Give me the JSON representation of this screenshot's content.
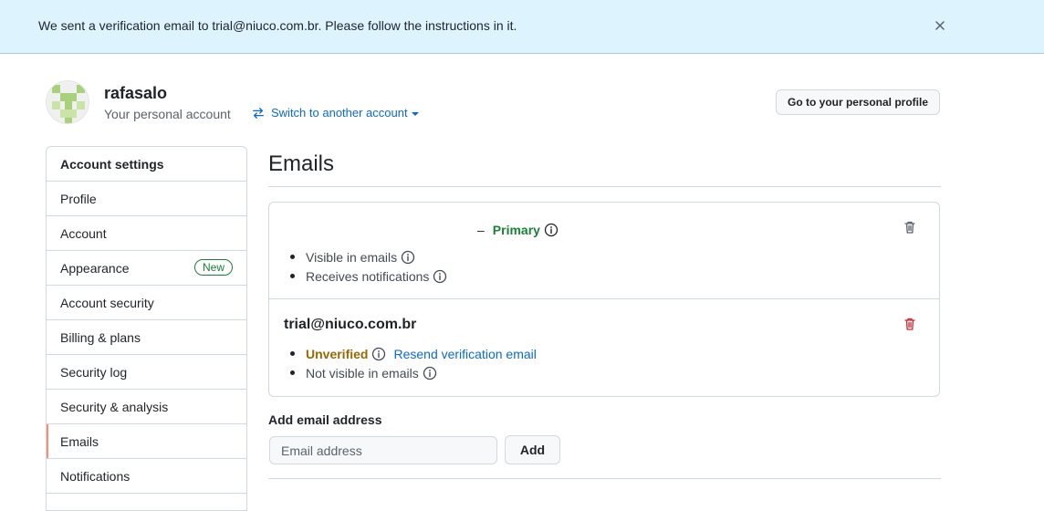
{
  "flash": {
    "message": "We sent a verification email to trial@niuco.com.br. Please follow the instructions in it.",
    "close_icon": "close-icon"
  },
  "header": {
    "username": "rafasalo",
    "subtitle": "Your personal account",
    "switch_label": "Switch to another account",
    "profile_button": "Go to your personal profile"
  },
  "sidebar": {
    "header": "Account settings",
    "items": [
      {
        "label": "Profile"
      },
      {
        "label": "Account"
      },
      {
        "label": "Appearance",
        "badge": "New"
      },
      {
        "label": "Account security"
      },
      {
        "label": "Billing & plans"
      },
      {
        "label": "Security log"
      },
      {
        "label": "Security & analysis"
      },
      {
        "label": "Emails",
        "selected": true
      },
      {
        "label": "Notifications"
      }
    ]
  },
  "main": {
    "title": "Emails",
    "primary_email": {
      "dash": "–",
      "primary_label": "Primary",
      "bullets": [
        "Visible in emails",
        "Receives notifications"
      ]
    },
    "secondary_email": {
      "address": "trial@niuco.com.br",
      "status": "Unverified",
      "resend_link": "Resend verification email",
      "visibility": "Not visible in emails"
    },
    "add_email": {
      "label": "Add email address",
      "placeholder": "Email address",
      "button": "Add"
    }
  },
  "colors": {
    "flash_bg": "#ddf4ff",
    "link": "#0969da",
    "success": "#1a7f37",
    "attention": "#9a6700",
    "danger": "#cf222e",
    "selected_marker": "#fd8c73"
  }
}
